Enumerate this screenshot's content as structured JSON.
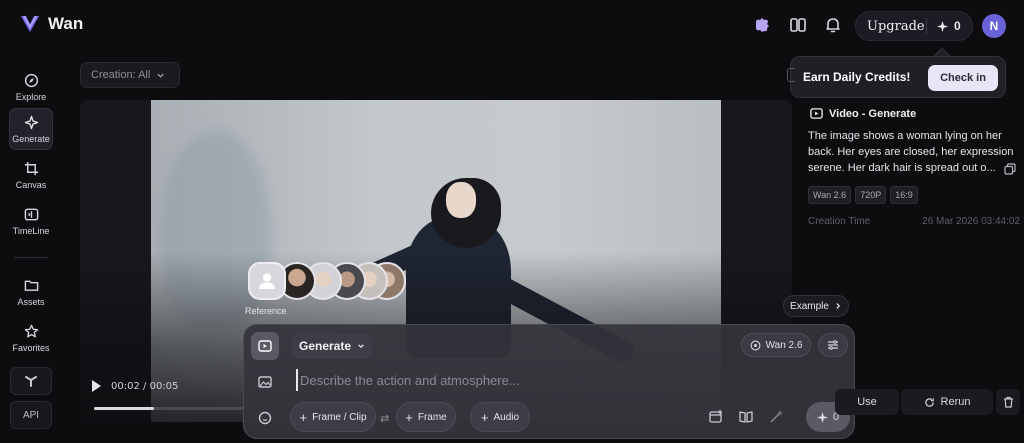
{
  "app": {
    "name": "Wan"
  },
  "header": {
    "upgrade_label": "Upgrade",
    "credits": "0",
    "avatar_initial": "N"
  },
  "credits_tooltip": {
    "text": "Earn Daily Credits!",
    "button": "Check in"
  },
  "sidebar": {
    "items": [
      {
        "label": "Explore",
        "icon": "compass-icon"
      },
      {
        "label": "Generate",
        "icon": "sparkle-icon",
        "active": true
      },
      {
        "label": "Canvas",
        "icon": "crop-icon"
      },
      {
        "label": "TimeLine",
        "icon": "timeline-icon"
      },
      {
        "label": "Assets",
        "icon": "folder-icon"
      },
      {
        "label": "Favorites",
        "icon": "star-icon"
      }
    ],
    "api_label": "API"
  },
  "filter": {
    "label": "Creation: All"
  },
  "player": {
    "current": "00:02",
    "separator": "/",
    "duration": "00:05",
    "progress": 0.4
  },
  "reference": {
    "label": "Reference"
  },
  "example": {
    "label": "Example"
  },
  "composer": {
    "mode": "Generate",
    "model": "Wan 2.6",
    "placeholder": "Describe the action and atmosphere...",
    "chips": {
      "frame_clip": "Frame / Clip",
      "frame": "Frame",
      "audio": "Audio"
    },
    "send_credits": "0"
  },
  "detail": {
    "title": "Video - Generate",
    "description": "The image shows a woman lying on her back. Her eyes are closed, her expression serene. Her dark hair is spread out o...",
    "tags": [
      "Wan 2.6",
      "720P",
      "16:9"
    ],
    "creation_label": "Creation Time",
    "creation_value": "26 Mar 2026 03:44:02",
    "use_label": "Use",
    "rerun_label": "Rerun"
  },
  "colors": {
    "accent": "#6a62d8",
    "background": "#0d0d10",
    "panel": "#34343c"
  }
}
